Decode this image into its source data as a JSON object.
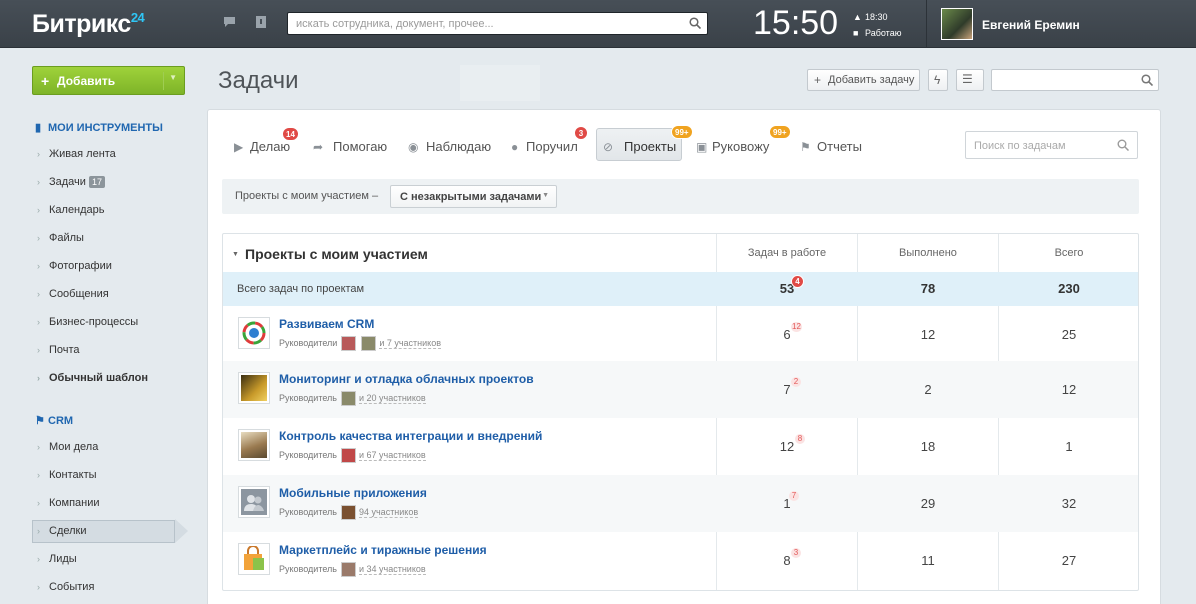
{
  "header": {
    "logo_text": "Битрикс",
    "logo_num": "24",
    "search_placeholder": "искать сотрудника, документ, прочее...",
    "clock": "15:50",
    "clock_time": "18:30",
    "clock_status": "Работаю",
    "user_name": "Евгений Еремин"
  },
  "sidebar": {
    "add_button": "Добавить",
    "section_tools": "МОИ ИНСТРУМЕНТЫ",
    "tools": [
      {
        "label": "Живая лента"
      },
      {
        "label": "Задачи",
        "badge": "17"
      },
      {
        "label": "Календарь"
      },
      {
        "label": "Файлы"
      },
      {
        "label": "Фотографии"
      },
      {
        "label": "Сообщения"
      },
      {
        "label": "Бизнес-процессы"
      },
      {
        "label": "Почта"
      },
      {
        "label": "Обычный шаблон"
      }
    ],
    "section_crm": "CRM",
    "crm": [
      {
        "label": "Мои дела"
      },
      {
        "label": "Контакты"
      },
      {
        "label": "Компании"
      },
      {
        "label": "Сделки"
      },
      {
        "label": "Лиды"
      },
      {
        "label": "События"
      }
    ]
  },
  "page": {
    "title": "Задачи",
    "add_task_button": "Добавить задачу"
  },
  "tabs": [
    {
      "label": "Делаю",
      "counter": "14"
    },
    {
      "label": "Помогаю"
    },
    {
      "label": "Наблюдаю"
    },
    {
      "label": "Поручил",
      "counter": "3"
    },
    {
      "label": "Проекты",
      "counter": "99+"
    },
    {
      "label": "Руковожу",
      "counter": "99+"
    },
    {
      "label": "Отчеты"
    }
  ],
  "task_search_placeholder": "Поиск по задачам",
  "filter": {
    "label": "Проекты с моим участием –",
    "selected": "С незакрытыми задачами"
  },
  "table": {
    "title": "Проекты с моим участием",
    "col_in_work": "Задач в работе",
    "col_done": "Выполнено",
    "col_total": "Всего",
    "total_label": "Всего задач по проектам",
    "total_in_work": "53",
    "total_in_work_sup": "4",
    "total_done": "78",
    "total_all": "230",
    "rows": [
      {
        "name": "Развиваем CRM",
        "managers": "Руководители",
        "participants": "и 7 участников",
        "in_work": "6",
        "sup": "12",
        "done": "12",
        "total": "25"
      },
      {
        "name": "Мониторинг и отладка облачных проектов",
        "managers": "Руководитель",
        "participants": "и 20 участников",
        "in_work": "7",
        "sup": "2",
        "done": "2",
        "total": "12"
      },
      {
        "name": "Контроль качества интеграции и внедрений",
        "managers": "Руководитель",
        "participants": "и 67 участников",
        "in_work": "12",
        "sup": "8",
        "done": "18",
        "total": "1"
      },
      {
        "name": "Мобильные приложения",
        "managers": "Руководитель",
        "participants": "94 участников",
        "in_work": "1",
        "sup": "7",
        "done": "29",
        "total": "32"
      },
      {
        "name": "Маркетплейс и тиражные решения",
        "managers": "Руководитель",
        "participants": "и 34 участников",
        "in_work": "8",
        "sup": "3",
        "done": "11",
        "total": "27"
      }
    ]
  }
}
